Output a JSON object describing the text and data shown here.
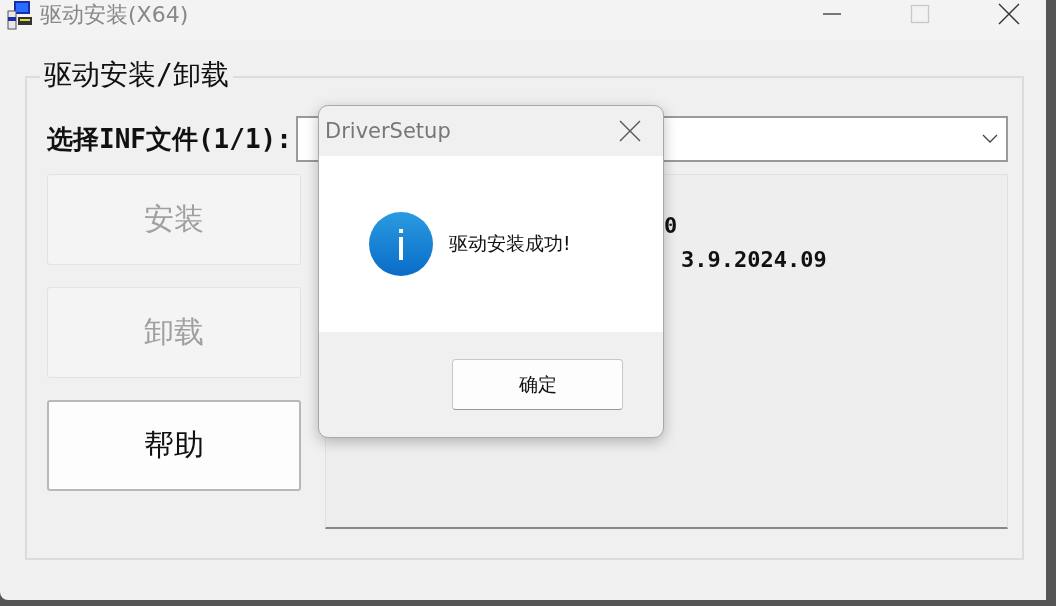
{
  "window": {
    "title": "驱动安装(X64)",
    "maximize_disabled": true
  },
  "group": {
    "title": "驱动安装/卸载"
  },
  "inf_select": {
    "label": "选择INF文件(1/1):"
  },
  "buttons": [
    {
      "label": "安装",
      "disabled": true
    },
    {
      "label": "卸载",
      "disabled": true
    },
    {
      "label": "帮助",
      "disabled": false
    }
  ],
  "info_lines": [
    "0",
    "3.9.2024.09"
  ],
  "dialog": {
    "title": "DriverSetup",
    "message": "驱动安装成功!",
    "button": "确定"
  }
}
